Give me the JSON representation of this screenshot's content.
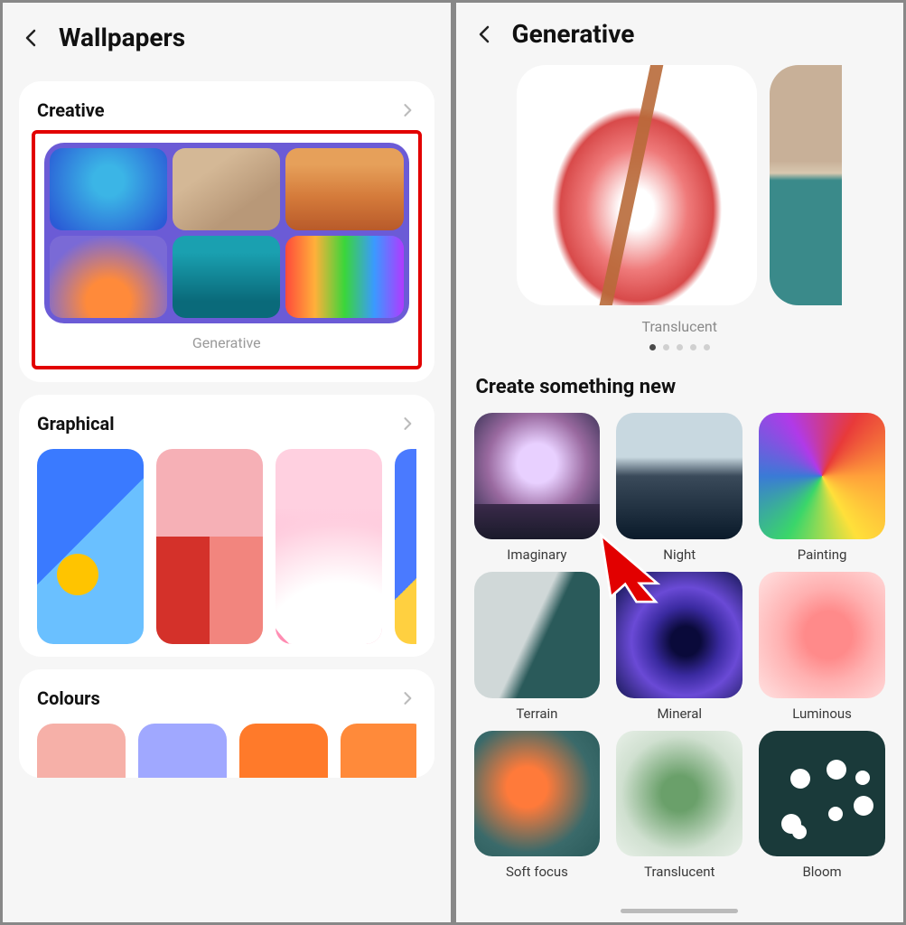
{
  "left": {
    "title": "Wallpapers",
    "creative": {
      "title": "Creative",
      "generative_caption": "Generative"
    },
    "graphical": {
      "title": "Graphical"
    },
    "colours": {
      "title": "Colours"
    }
  },
  "right": {
    "title": "Generative",
    "hero_caption": "Translucent",
    "dots": {
      "total": 5,
      "active": 0
    },
    "subheading": "Create something new",
    "styles": [
      {
        "label": "Imaginary",
        "cls": "st-imaginary"
      },
      {
        "label": "Night",
        "cls": "st-night"
      },
      {
        "label": "Painting",
        "cls": "st-painting"
      },
      {
        "label": "Terrain",
        "cls": "st-terrain"
      },
      {
        "label": "Mineral",
        "cls": "st-mineral"
      },
      {
        "label": "Luminous",
        "cls": "st-luminous"
      },
      {
        "label": "Soft focus",
        "cls": "st-softfocus"
      },
      {
        "label": "Translucent",
        "cls": "st-translucent"
      },
      {
        "label": "Bloom",
        "cls": "st-bloom"
      }
    ]
  },
  "annotation": {
    "highlight": "red",
    "cursor_target": "Imaginary"
  }
}
